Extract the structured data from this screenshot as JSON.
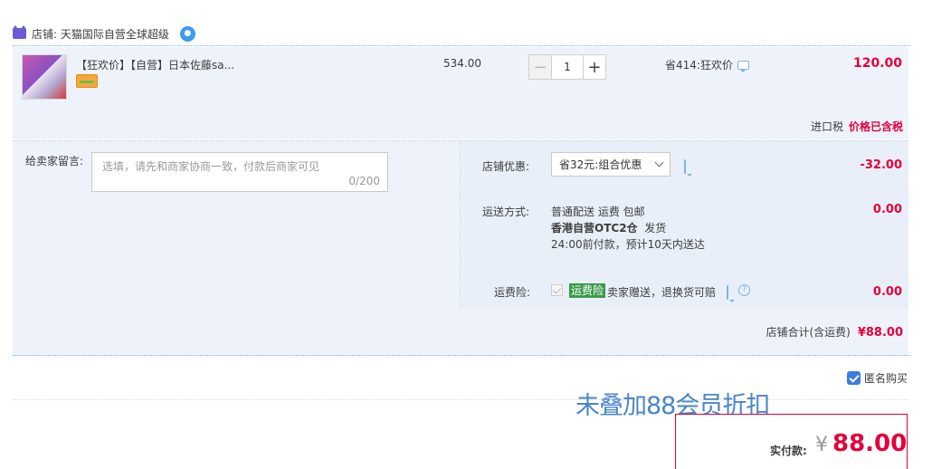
{
  "shop": {
    "label": "店铺: 天猫国际自营全球超级",
    "icon": "tmall-cat-icon",
    "chat_icon": "wangwang-chat-icon"
  },
  "item": {
    "title": "【狂欢价】【自营】日本佐藤sa...",
    "unit_price": "534.00",
    "quantity": "1",
    "discount_note": "省414:狂欢价",
    "subtotal": "120.00",
    "tax_label": "进口税",
    "tax_status": "价格已含税"
  },
  "message": {
    "label": "给卖家留言:",
    "placeholder": "选填，请先和商家协商一致，付款后商家可见",
    "count": "0/200"
  },
  "coupon": {
    "label": "店铺优惠:",
    "selected": "省32元:组合优惠",
    "amount": "-32.00"
  },
  "shipping": {
    "label": "运送方式:",
    "line1": "普通配送 运费 包邮",
    "line2_bold": "香港自营OTC2仓",
    "line2_rest": "发货",
    "line3": "24:00前付款，预计10天内送达",
    "amount": "0.00"
  },
  "insurance": {
    "label": "运费险:",
    "badge": "运费险",
    "text": "卖家赠送，退换货可赔",
    "amount": "0.00"
  },
  "shop_total": {
    "label": "店铺合计(含运费)",
    "amount": "¥88.00"
  },
  "anonymous": {
    "label": "匿名购买",
    "checked": true
  },
  "overlay_note": "未叠加88会员折扣",
  "payment": {
    "label": "实付款:",
    "currency": "¥",
    "amount": "88.00"
  },
  "colors": {
    "price_red": "#e4003a",
    "panel_blue": "#eef3fb",
    "link_blue": "#3a7be0"
  }
}
